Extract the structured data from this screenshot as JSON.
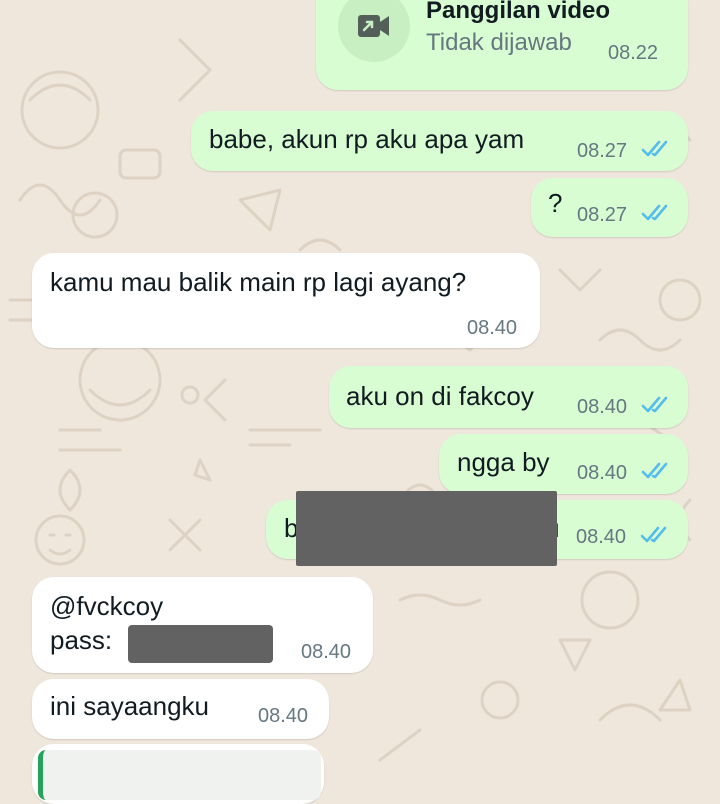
{
  "colors": {
    "outgoing_bubble": "#d9fdd3",
    "incoming_bubble": "#ffffff",
    "background": "#efe7dc",
    "read_ticks": "#53bdeb",
    "timestamp": "#667781",
    "quote_bar": "#25a35a"
  },
  "messages": {
    "call": {
      "title": "Panggilan video",
      "status": "Tidak dijawab",
      "time": "08.22",
      "icon": "video-camera-missed-icon"
    },
    "m1": {
      "text": "babe, akun rp aku apa yam",
      "time": "08.27",
      "status": "read"
    },
    "m2": {
      "text": "?",
      "time": "08.27",
      "status": "read"
    },
    "m3": {
      "text": "kamu mau balik main rp lagi ayang?",
      "time": "08.40"
    },
    "m4": {
      "text": "aku on di fakcoy",
      "time": "08.40",
      "status": "read"
    },
    "m5": {
      "text": "ngga by",
      "time": "08.40",
      "status": "read"
    },
    "m6": {
      "text_visible": "b",
      "time": "08.40",
      "status": "read"
    },
    "m7": {
      "line1": "@fvckcoy",
      "line2": "pass:",
      "time": "08.40"
    },
    "m8": {
      "text": "ini sayaangku",
      "time": "08.40"
    }
  }
}
